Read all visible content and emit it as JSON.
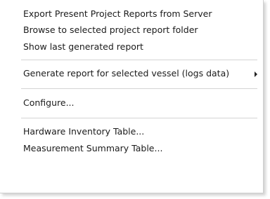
{
  "menu": {
    "items": [
      {
        "label": "Export Present Project Reports from Server"
      },
      {
        "label": "Browse to selected project report folder"
      },
      {
        "label": "Show last generated report"
      },
      {
        "label": "Generate report for selected vessel (logs data)"
      },
      {
        "label": "Configure..."
      },
      {
        "label": "Hardware Inventory Table..."
      },
      {
        "label": "Measurement Summary Table..."
      }
    ],
    "submenu_icon": "chevron-right-icon"
  }
}
